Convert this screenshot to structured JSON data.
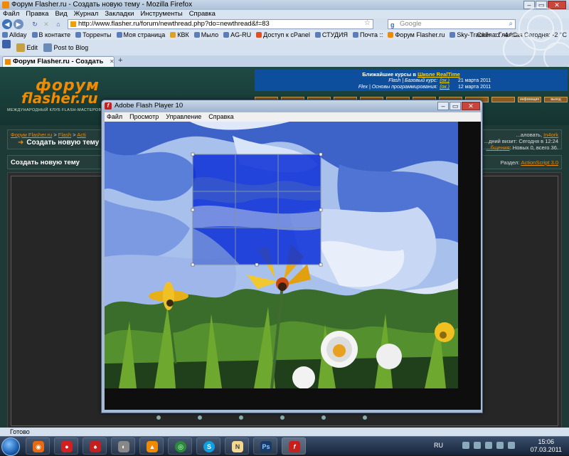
{
  "browser": {
    "window_title": "Форум Flasher.ru - Создать новую тему - Mozilla Firefox",
    "menu": [
      "Файл",
      "Правка",
      "Вид",
      "Журнал",
      "Закладки",
      "Инструменты",
      "Справка"
    ],
    "url": "http://www.flasher.ru/forum/newthread.php?do=newthread&f=83",
    "search_placeholder": "Google",
    "bookmarks": [
      "Allday",
      "В контакте",
      "Торренты",
      "Моя страница",
      "КВК",
      "Мыло",
      "AG-RU",
      "Доступ к cPanel",
      "СТУДИЯ",
      "Почта ::",
      "Форум Flasher.ru",
      "Sky-Tracker :: Главная"
    ],
    "weather": [
      "Сейчас: -4 °C",
      "Сегодня: -2 °C"
    ],
    "toolbar2": [
      "Edit",
      "Post to Blog"
    ],
    "tab_title": "Форум Flasher.ru - Создать новую т...",
    "status": "Готово"
  },
  "site": {
    "logo_line1": "форум",
    "logo_line2": "flasher.ru",
    "logo_tagline": "МЕЖДУНАРОДНЫЙ КЛУБ FLASH-МАСТЕРОВ",
    "courses": {
      "heading_prefix": "Ближайшие курсы в",
      "heading_link": "Школе RealTime",
      "rows": [
        {
          "text": "Flash | Базовый курс:",
          "link": "(ок.)",
          "date": "21 марта 2011"
        },
        {
          "text": "Flex | Основы программирования:",
          "link": "(ок.)",
          "date": "12 марта 2011"
        }
      ]
    },
    "nav_buttons": [
      "",
      "",
      "",
      "",
      "",
      "",
      "",
      "",
      "",
      "",
      "инфомация",
      "выход"
    ],
    "breadcrumb": [
      "Форум Flasher.ru",
      ">",
      "Flash",
      ">",
      "Acti"
    ],
    "page_title": "Создать новую тему",
    "userbox": {
      "line1_prefix": "...аловать,",
      "line1_user": "In4ork",
      "line2": "...дний визит: Сегодня в 12:24",
      "line3_link": "...бщения",
      "line3_rest": ": Новых 0, всего 36."
    },
    "newtopic_title": "Создать новую тему",
    "section_label": "Раздел:",
    "section_value": "ActionScript 3.0"
  },
  "flash": {
    "title": "Adobe Flash Player 10",
    "menu": [
      "Файл",
      "Просмотр",
      "Управление",
      "Справка"
    ]
  },
  "taskbar": {
    "apps": [
      "firefox",
      "pidgin",
      "chess",
      "media",
      "vlc",
      "chrome",
      "skype",
      "notepad",
      "photoshop",
      "flash"
    ],
    "tray_lang": "RU",
    "time": "15:06",
    "date": "07.03.2011"
  }
}
